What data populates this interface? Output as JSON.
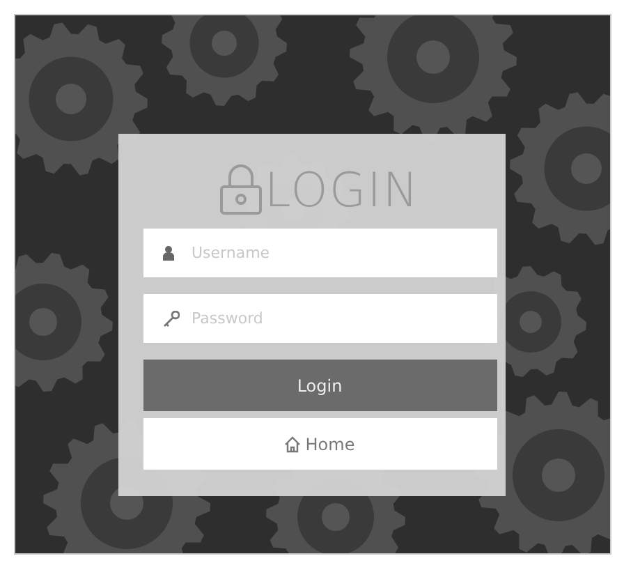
{
  "login_panel": {
    "title": "LOGIN",
    "fields": [
      {
        "kind": "user",
        "placeholder": "Username"
      },
      {
        "kind": "password",
        "placeholder": "Password"
      }
    ],
    "buttons": [
      {
        "kind": "primary",
        "label": "Login"
      },
      {
        "kind": "home",
        "label": "Home"
      }
    ]
  }
}
